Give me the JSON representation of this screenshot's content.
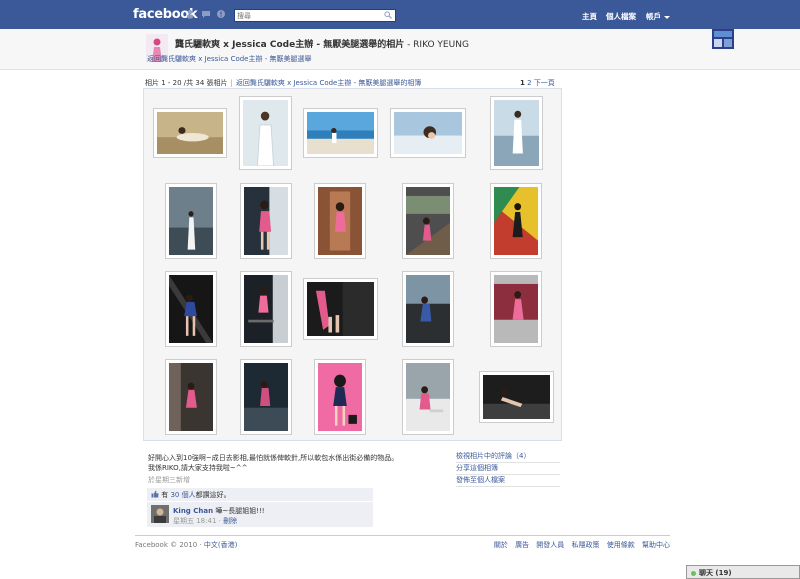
{
  "topbar": {
    "logo": "facebook",
    "search_placeholder": "搜尋",
    "nav_home": "主頁",
    "nav_profile": "個人檔案",
    "nav_account": "帳戶"
  },
  "album": {
    "title": "龔氏驪軟爽 x Jessica Code主辦 - 無厭美腿選舉的相片",
    "title_suffix": " - RIKO YEUNG",
    "back_link": "返回龔氏驪軟爽 x Jessica Code主辦 - 無厭美腿選舉",
    "info": "相片 1 - 20 /共 34 張相片",
    "album_link": "返回龔氏驪軟爽 x Jessica Code主辦 - 無厭美腿選舉的相簿",
    "pager_current": "1",
    "pager_next_num": "2",
    "pager_next": "下一頁"
  },
  "caption": {
    "line1": "好開心入到10強啊~成日去影相,最怕就係俾軟針,所以軟包水係出街必備的物品。",
    "line2": "我係RIKO,請大家支持我啦~^^",
    "posted": "於星期三新增"
  },
  "likes": {
    "prefix": "有",
    "count_link": "30 個人",
    "suffix": "都讚這好。"
  },
  "comment": {
    "author": "King Chan",
    "text": "嘩~長腿姐姐!!!",
    "time": "星期五 18:41",
    "delete": "刪除"
  },
  "sidelinks": [
    "檢視相片中的評論（4）",
    "分享這個相簿",
    "發佈至個人檔案"
  ],
  "footer": {
    "copyright": "Facebook © 2010",
    "language": "中文(香港)",
    "links": [
      "關於",
      "廣告",
      "開發人員",
      "私隱政策",
      "使用條款",
      "幫助中心"
    ]
  },
  "chat": {
    "label": "聊天 (19)"
  },
  "colors": {
    "brand": "#3b5998",
    "link": "#3b5998",
    "gallery_bg": "#f5f5f5"
  }
}
